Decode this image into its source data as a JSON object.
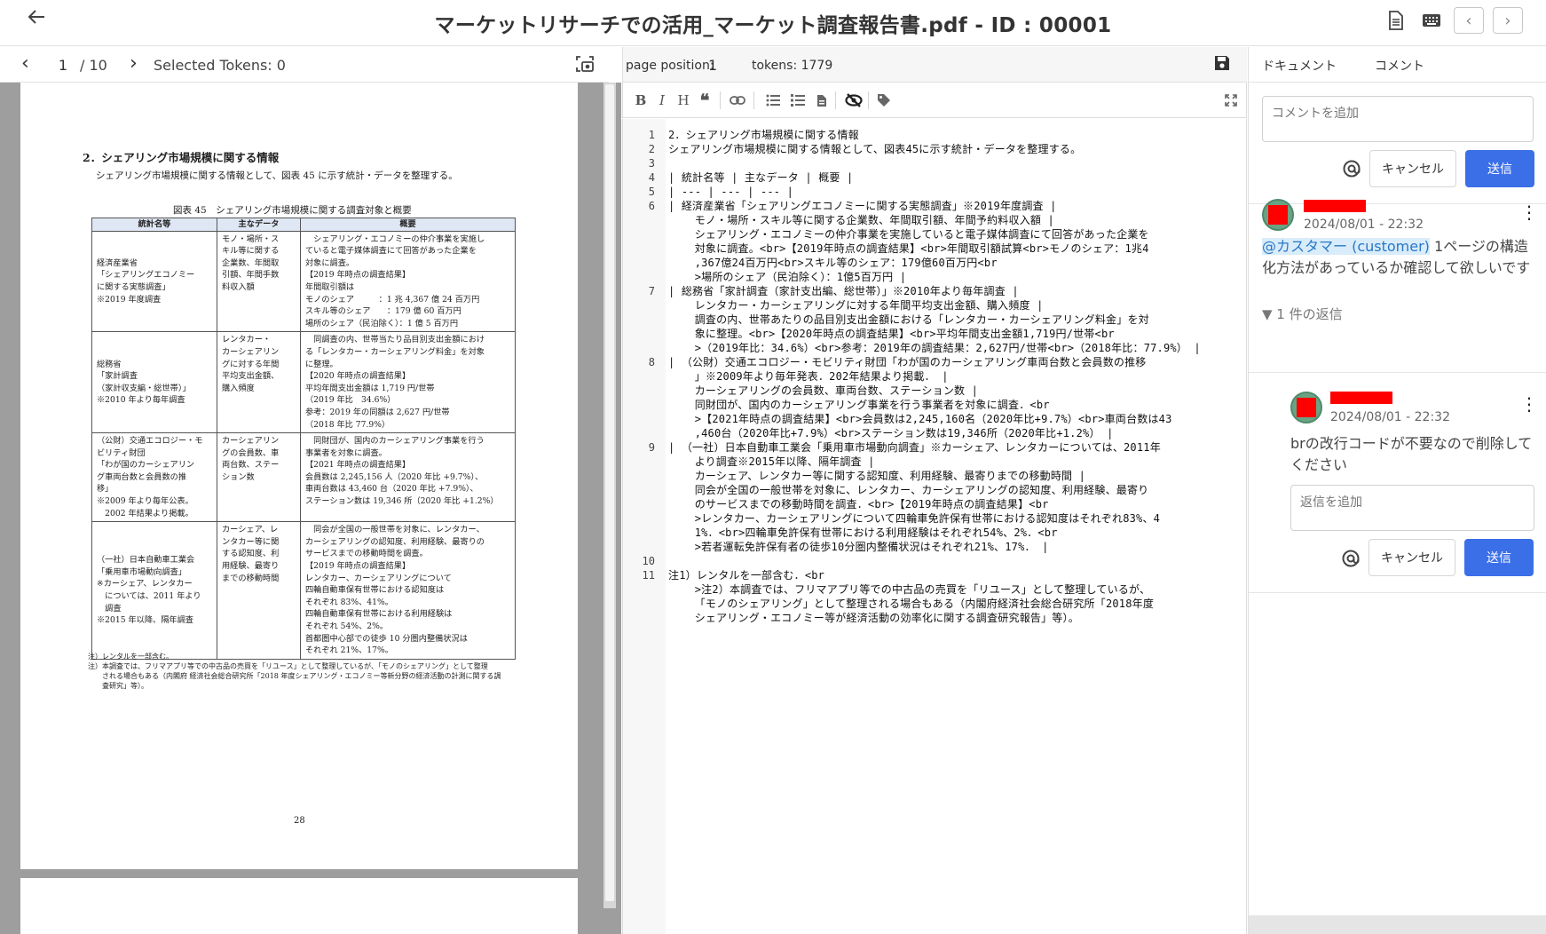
{
  "header": {
    "back_icon": "arrow-left-icon",
    "title": "マーケットリサーチでの活用_マーケット調査報告書.pdf - ID : 00001",
    "icons": [
      "document-icon",
      "keyboard-icon",
      "chevron-left-icon",
      "chevron-right-icon"
    ]
  },
  "pdf_viewer": {
    "page": "1",
    "total": "/ 10",
    "selected_tokens": "Selected Tokens: 0",
    "page_content": {
      "heading": "2．シェアリング市場規模に関する情報",
      "intro": "シェアリング市場規模に関する情報として、図表 45 に示す統計・データを整理する。",
      "caption": "図表 45　シェアリング市場規模に関する調査対象と概要",
      "table_headers": [
        "統計名等",
        "主なデータ",
        "概要"
      ],
      "rows": [
        {
          "name": "経済産業省\n「シェアリングエコノミー\nに関する実態調査」\n※2019 年度調査",
          "data": "モノ・場所・ス\nキル等に関する\n企業数、年間取\n引額、年間手数\n料収入額",
          "summary": "　シェアリング・エコノミーの仲介事業を実施し\nていると電子媒体調査にて回答があった企業を\n対象に調査。\n【2019 年時点の調査結果】\n年間取引額は\nモノのシェア　　　：1 兆 4,367 億 24 百万円\nスキル等のシェア　　：179 億 60 百万円\n場所のシェア（民泊除く）：1 億 5 百万円"
        },
        {
          "name": "総務省\n「家計調査\n（家計収支編・総世帯）」\n※2010 年より毎年調査",
          "data": "レンタカー・\nカーシェアリン\nグに対する年間\n平均支出金額、\n購入頻度",
          "summary": "　同調査の内、世帯当たり品目別支出金額におけ\nる「レンタカー・カーシェアリング料金」を対象\nに整理。\n【2020 年時点の調査結果】\n平均年間支出金額は 1,719 円/世帯\n（2019 年比　34.6%）\n参考：2019 年の同額は 2,627 円/世帯\n（2018 年比 77.9%）"
        },
        {
          "name": "（公財）交通エコロジー・モ\nビリティ財団\n「わが国のカーシェアリン\nグ車両台数と会員数の推\n移」\n※2009 年より毎年公表。\n　2002 年結果より掲載。",
          "data": "カーシェアリン\nグの会員数、車\n両台数、ステー\nション数",
          "summary": "　同財団が、国内のカーシェアリング事業を行う\n事業者を対象に調査。\n【2021 年時点の調査結果】\n会員数は 2,245,156 人（2020 年比 +9.7%）、\n車両台数は 43,460 台（2020 年比 +7.9%）、\nステーション数は 19,346 所（2020 年比 +1.2%）"
        },
        {
          "name": "（一社）日本自動車工業会\n「乗用車市場動向調査」\n※カーシェア、レンタカー\n　については、2011 年より\n　調査\n※2015 年以降、隔年調査",
          "data": "カーシェア、レ\nンタカー等に関\nする認知度、利\n用経験、最寄り\nまでの移動時間",
          "summary": "　同会が全国の一般世帯を対象に、レンタカー、\nカーシェアリングの認知度、利用経験、最寄りの\nサービスまでの移動時間を調査。\n【2019 年時点の調査結果】\nレンタカー、カーシェアリングについて\n四輪自動車保有世帯における認知度は\nそれぞれ 83%、41%。\n四輪自動車保有世帯における利用経験は\nそれぞれ 54%、2%。\n首都圏中心部での徒歩 10 分圏内整備状況は\nそれぞれ 21%、17%。"
        }
      ],
      "notes": "注）レンタルを一部含む。\n注）本調査では、フリマアプリ等での中古品の売買を「リユース」として整理しているが、「モノのシェアリング」として整理\n　　される場合もある（内閣府 経済社会総合研究所「2018 年度シェアリング・エコノミー等新分野の経済活動の計測に関する調\n　　査研究」等）。",
      "page_number": "28"
    }
  },
  "editor": {
    "page_position_label": "page position:",
    "page_position_value": "1",
    "tokens": "tokens: 1779",
    "toolbar": [
      "bold-icon",
      "italic-icon",
      "heading-icon",
      "quote-icon",
      "link-icon",
      "bullet-list-icon",
      "numbered-list-icon",
      "file-icon",
      "preview-hide-icon",
      "tag-icon",
      "fullscreen-icon"
    ],
    "lines": [
      {
        "n": "1",
        "text": "2．シェアリング市場規模に関する情報"
      },
      {
        "n": "2",
        "text": "シェアリング市場規模に関する情報として、図表45に示す統計・データを整理する。"
      },
      {
        "n": "3",
        "text": ""
      },
      {
        "n": "4",
        "text": "| 統計名等 | 主なデータ | 概要 |"
      },
      {
        "n": "5",
        "text": "| --- | --- | --- |"
      },
      {
        "n": "6",
        "text": "| 経済産業省「シェアリングエコノミーに関する実態調査」※2019年度調査 |"
      },
      {
        "n": "",
        "text": "    モノ・場所・スキル等に関する企業数、年間取引額、年間予約料収入額 |"
      },
      {
        "n": "",
        "text": "    シェアリング・エコノミーの仲介事業を実施していると電子媒体調査にて回答があった企業を"
      },
      {
        "n": "",
        "text": "    対象に調査。<br>【2019年時点の調査結果】<br>年間取引額試算<br>モノのシェア：1兆4"
      },
      {
        "n": "",
        "text": "    ,367億24百万円<br>スキル等のシェア：179億60百万円<br"
      },
      {
        "n": "",
        "text": "    >場所のシェア（民泊除く）：1億5百万円 |"
      },
      {
        "n": "7",
        "text": "| 総務省「家計調査（家計支出編、総世帯）」※2010年より毎年調査 |"
      },
      {
        "n": "",
        "text": "    レンタカー・カーシェアリングに対する年間平均支出金額、購入頻度 |"
      },
      {
        "n": "",
        "text": "    調査の内、世帯あたりの品目別支出金額における「レンタカー・カーシェアリング料金」を対"
      },
      {
        "n": "",
        "text": "    象に整理。<br>【2020年時点の調査結果】<br>平均年間支出金額1,719円/世帯<br"
      },
      {
        "n": "",
        "text": "    >（2019年比：34.6%）<br>参考：2019年の調査結果：2,627円/世帯<br>（2018年比：77.9%） |"
      },
      {
        "n": "8",
        "text": "| （公財）交通エコロジー・モビリティ財団「わが国のカーシェアリング車両台数と会員数の推移"
      },
      {
        "n": "",
        "text": "    」※2009年より毎年発表．202年結果より掲載． |"
      },
      {
        "n": "",
        "text": "    カーシェアリングの会員数、車両台数、ステーション数 |"
      },
      {
        "n": "",
        "text": "    同財団が、国内のカーシェアリング事業を行う事業者を対象に調査．<br"
      },
      {
        "n": "",
        "text": "    >【2021年時点の調査結果】<br>会員数は2,245,160名（2020年比+9.7%）<br>車両台数は43"
      },
      {
        "n": "",
        "text": "    ,460台（2020年比+7.9%）<br>ステーション数は19,346所（2020年比+1.2%） |"
      },
      {
        "n": "9",
        "text": "| （一社）日本自動車工業会「乗用車市場動向調査」※カーシェア、レンタカーについては、2011年"
      },
      {
        "n": "",
        "text": "    より調査※2015年以降、隔年調査 |"
      },
      {
        "n": "",
        "text": "    カーシェア、レンタカー等に関する認知度、利用経験、最寄りまでの移動時間 |"
      },
      {
        "n": "",
        "text": "    同会が全国の一般世帯を対象に、レンタカー、カーシェアリングの認知度、利用経験、最寄り"
      },
      {
        "n": "",
        "text": "    のサービスまでの移動時間を調査．<br>【2019年時点の調査結果】<br"
      },
      {
        "n": "",
        "text": "    >レンタカー、カーシェアリングについて四輪車免許保有世帯における認知度はそれぞれ83%、4"
      },
      {
        "n": "",
        "text": "    1%．<br>四輪車免許保有世帯における利用経験はそれぞれ54%、2%．<br"
      },
      {
        "n": "",
        "text": "    >若者運転免許保有者の徒歩10分圏内整備状況はそれぞれ21%、17%． |"
      },
      {
        "n": "10",
        "text": ""
      },
      {
        "n": "11",
        "text": "注1）レンタルを一部含む．<br"
      },
      {
        "n": "",
        "text": "    >注2）本調査では、フリマアプリ等での中古品の売買を「リユース」として整理しているが、"
      },
      {
        "n": "",
        "text": "    「モノのシェアリング」として整理される場合もある（内閣府経済社会総合研究所「2018年度"
      },
      {
        "n": "",
        "text": "    シェアリング・エコノミー等が経済活動の効率化に関する調査研究報告」等）。"
      }
    ]
  },
  "comments_panel": {
    "tabs": [
      "ドキュメント",
      "コメント"
    ],
    "new_comment_placeholder": "コメントを追加",
    "cancel_label": "キャンセル",
    "send_label": "送信",
    "comments": [
      {
        "date": "2024/08/01 - 22:32",
        "mention": "@カスタマー (customer)",
        "body": " 1ページの構造化方法があっているか確認して欲しいです",
        "replies": "▼ 1 件の返信"
      },
      {
        "date": "2024/08/01 - 22:32",
        "body": "brの改行コードが不要なので削除してください"
      }
    ],
    "reply_placeholder": "返信を追加"
  }
}
